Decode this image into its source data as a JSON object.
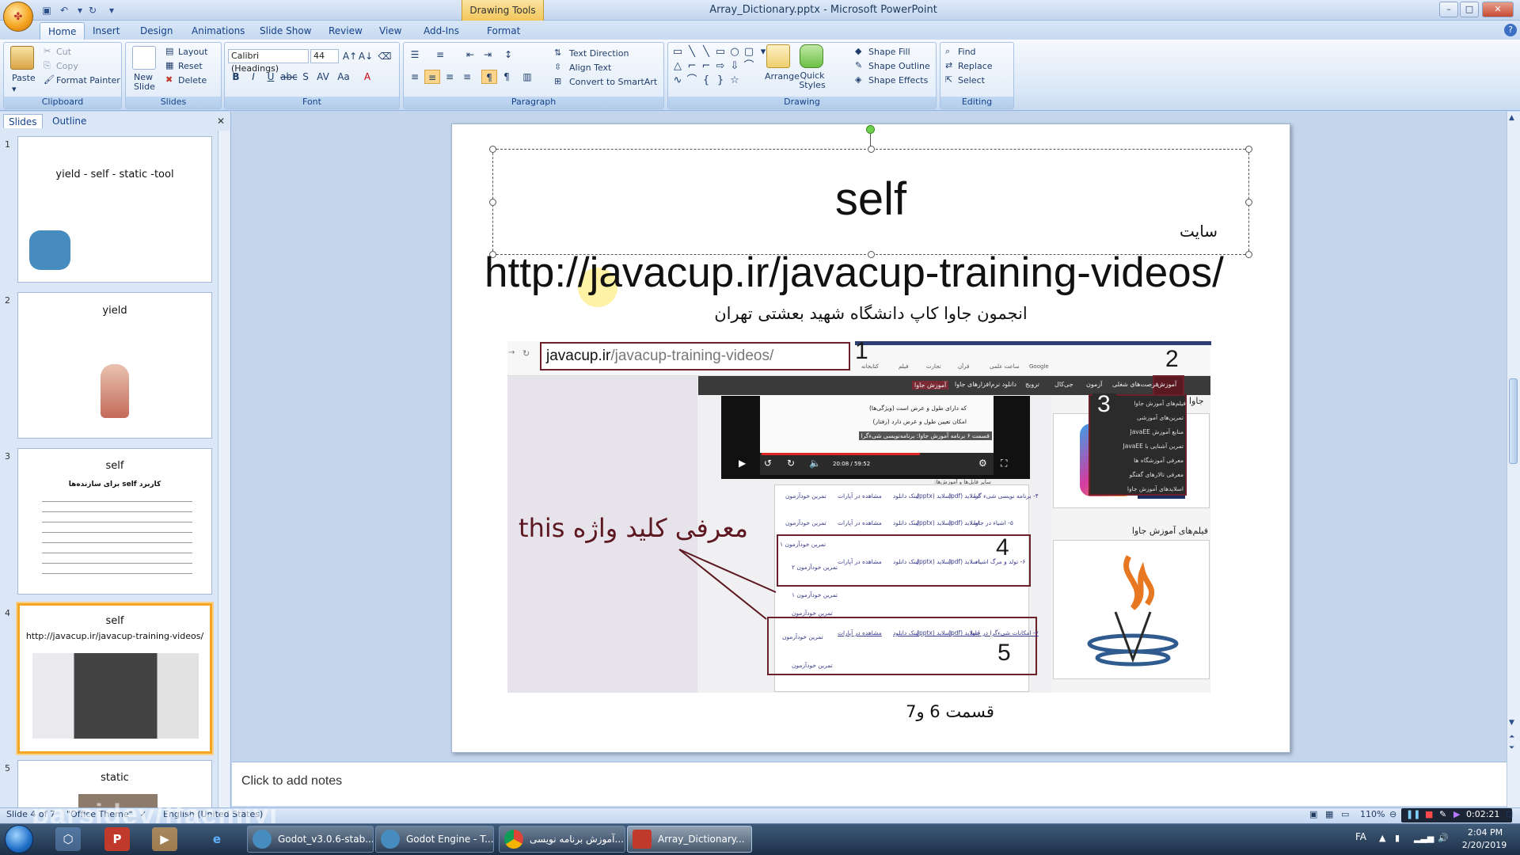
{
  "titlebar": {
    "context_tab": "Drawing Tools",
    "window_title": "Array_Dictionary.pptx - Microsoft PowerPoint",
    "minimize": "–",
    "maximize": "□",
    "close": "✕"
  },
  "ribbon_tabs": [
    "Home",
    "Insert",
    "Design",
    "Animations",
    "Slide Show",
    "Review",
    "View",
    "Add-Ins",
    "Format"
  ],
  "ribbon": {
    "clipboard": {
      "label": "Clipboard",
      "paste": "Paste",
      "cut": "Cut",
      "copy": "Copy",
      "format_painter": "Format Painter"
    },
    "slides": {
      "label": "Slides",
      "new_slide": "New Slide",
      "layout": "Layout",
      "reset": "Reset",
      "delete": "Delete"
    },
    "font": {
      "label": "Font",
      "font_name": "Calibri (Headings)",
      "font_size": "44"
    },
    "paragraph": {
      "label": "Paragraph",
      "text_direction": "Text Direction",
      "align_text": "Align Text",
      "convert_smartart": "Convert to SmartArt"
    },
    "drawing": {
      "label": "Drawing",
      "arrange": "Arrange",
      "quick_styles": "Quick Styles",
      "shape_fill": "Shape Fill",
      "shape_outline": "Shape Outline",
      "shape_effects": "Shape Effects"
    },
    "editing": {
      "label": "Editing",
      "find": "Find",
      "replace": "Replace",
      "select": "Select"
    }
  },
  "slides_pane": {
    "tabs": [
      "Slides",
      "Outline"
    ],
    "thumbnails": [
      {
        "num": "1",
        "title": "yield - self - static -tool"
      },
      {
        "num": "2",
        "title": "yield"
      },
      {
        "num": "3",
        "title": "self",
        "heading": "کاربرد self برای سازنده‌ها"
      },
      {
        "num": "4",
        "title": "self",
        "url": "http://javacup.ir/javacup-training-videos/"
      },
      {
        "num": "5",
        "title": "static"
      }
    ]
  },
  "slide": {
    "title": "self",
    "site_label": "سایت",
    "url": "http://javacup.ir/javacup-training-videos/",
    "subtitle": "انجمون جاوا کاپ دانشگاه شهید بعشتی تهران",
    "episode": "قسمت 6 و7",
    "shot": {
      "url_host": "javacup.ir",
      "url_path": "/javacup-training-videos/",
      "nav_items": [
        "آموزش",
        "فرصت‌های شغلی",
        "آزمون",
        "جی‌کال",
        "ترویج",
        "دانلود نرم‌افزارهای جاوا",
        "آموزش جاوا"
      ],
      "bookmarks": [
        "Google",
        "ساعت علمی",
        "قرآن",
        "تجارت",
        "فیلم",
        "کتابخانه"
      ],
      "dropdown": [
        "فیلم‌های آموزش جاوا",
        "تمرین‌های آموزشی",
        "منابع آموزش JavaEE",
        "تمرین آشنایی با JavaEE",
        "معرفی آموزشگاه ها",
        "معرفی تالارهای گفتگو",
        "اسلایدهای آموزش جاوا"
      ],
      "video_lines": [
        "که دارای طول و عرض است (ویژگی‌ها)",
        "امکان تعیین طول و عرض دارد (رفتار)",
        "قسمت ۶ برنامه آموزش جاوا: برنامه‌نویسی شیءگرا"
      ],
      "video_time": "20:08 / 59:52",
      "video_caption": "سایر فایل‌ها و آموزش‌ها:",
      "rows": [
        {
          "title": "۴- برنامه نویسی شیء گرا",
          "pdf": "اسلاید (pdf)",
          "pptx": "اسلاید (pptx)",
          "dl": "لینک دانلود",
          "aparat": "مشاهده در آپارات",
          "test": "تمرین خودآزمون"
        },
        {
          "title": "۵- اشیاء در جاوا",
          "pdf": "اسلاید (pdf)",
          "pptx": "اسلاید (pptx)",
          "dl": "لینک دانلود",
          "aparat": "مشاهده در آپارات",
          "test": "تمرین خودآزمون"
        },
        {
          "title": "۶- تولد و مرگ اشیاء",
          "pdf": "اسلاید (pdf)",
          "pptx": "اسلاید (pptx)",
          "dl": "لینک دانلود",
          "aparat": "مشاهده در آپارات",
          "test": "تمرین خودآزمون"
        },
        {
          "title": "۷- امکانات شیءگرا در جاوا",
          "pdf": "اسلاید (pdf)",
          "pptx": "اسلاید (pptx)",
          "dl": "لینک دانلود",
          "aparat": "مشاهده در آپارات",
          "test": "تمرین خودآزمون"
        }
      ],
      "test_labels": [
        "تمرین خودآزمون ۱",
        "تمرین خودآزمون ۲",
        "تمرین خودآزمون ۱",
        "تمرین خودآزمون"
      ],
      "films_label": "فیلم‌های آموزش جاوا",
      "java_label": "جاوا",
      "callouts": [
        "1",
        "2",
        "3",
        "4",
        "5"
      ],
      "this_label": "معرفی کلید واژه this"
    }
  },
  "notes": {
    "placeholder": "Click to add notes"
  },
  "statusbar": {
    "slide_info": "Slide 4 of 7",
    "theme": "\"Office Theme\"",
    "language": "English (United States)",
    "zoom": "110%",
    "recorder_time": "0:02:21",
    "watermark": "parsidev/ffaemiyi"
  },
  "taskbar": {
    "tasks": [
      "Godot_v3.0.6-stab...",
      "Godot Engine - T...",
      "آموزش برنامه نویسی...",
      "Array_Dictionary..."
    ],
    "lang": "FA",
    "time": "2:04 PM",
    "date": "2/20/2019"
  }
}
